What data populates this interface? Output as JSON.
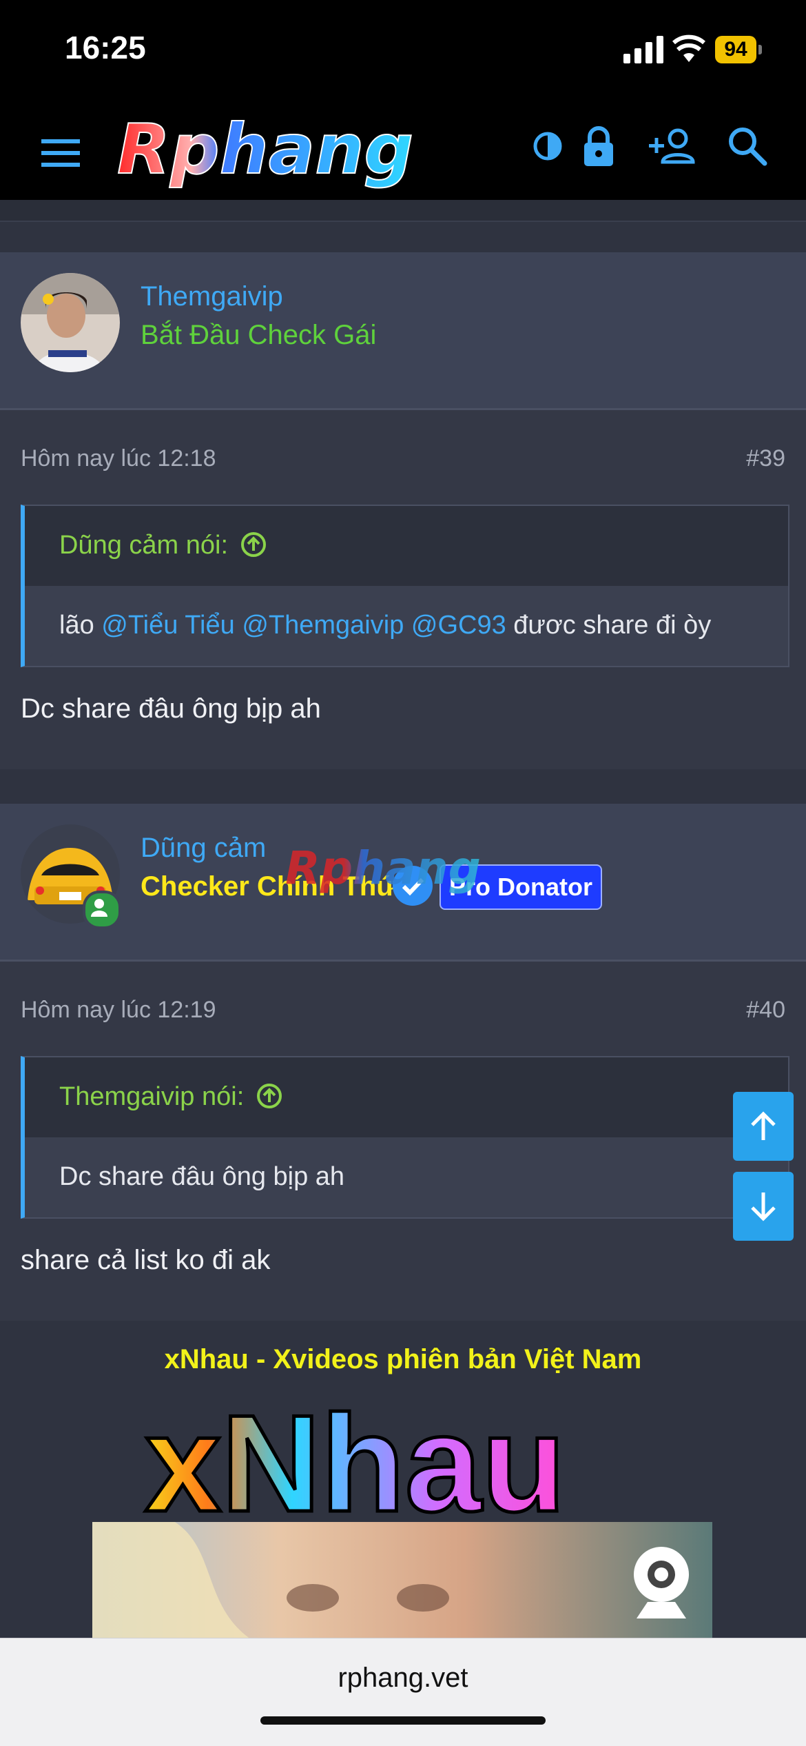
{
  "status": {
    "time": "16:25",
    "battery": "94"
  },
  "site": {
    "logo_text": "Rphang",
    "url": "rphang.vet"
  },
  "header_icons": [
    "menu-icon",
    "theme-toggle-icon",
    "lock-icon",
    "add-user-icon",
    "search-icon"
  ],
  "posts": [
    {
      "username": "Themgaivip",
      "user_title": "Bắt Đầu Check Gái",
      "user_title_color": "#5fd23c",
      "timestamp": "Hôm nay lúc 12:18",
      "number": "#39",
      "quote_author": "Dũng cảm nói:",
      "quote_parts": {
        "before": "lão ",
        "m1": "@Tiểu Tiểu",
        "sp1": " ",
        "m2": "@Themgaivip",
        "sp2": " ",
        "m3": "@GC93",
        "after": " đươc share đi òy"
      },
      "text": "Dc share đâu ông bịp ah"
    },
    {
      "username": "Dũng cảm",
      "user_title": "Checker Chính Thức",
      "user_title_color": "#ffe81a",
      "badge": "Pro Donator",
      "timestamp": "Hôm nay lúc 12:19",
      "number": "#40",
      "quote_author": "Themgaivip nói:",
      "quote_text": "Dc share đâu ông bịp ah",
      "text": "share cả list ko đi ak"
    }
  ],
  "ad": {
    "title": "xNhau - Xvideos phiên bản Việt Nam",
    "logo_text": "xNhau"
  },
  "colors": {
    "accent": "#3fa9f5",
    "quote_author": "#8bd34a",
    "fab": "#29a3ec"
  }
}
